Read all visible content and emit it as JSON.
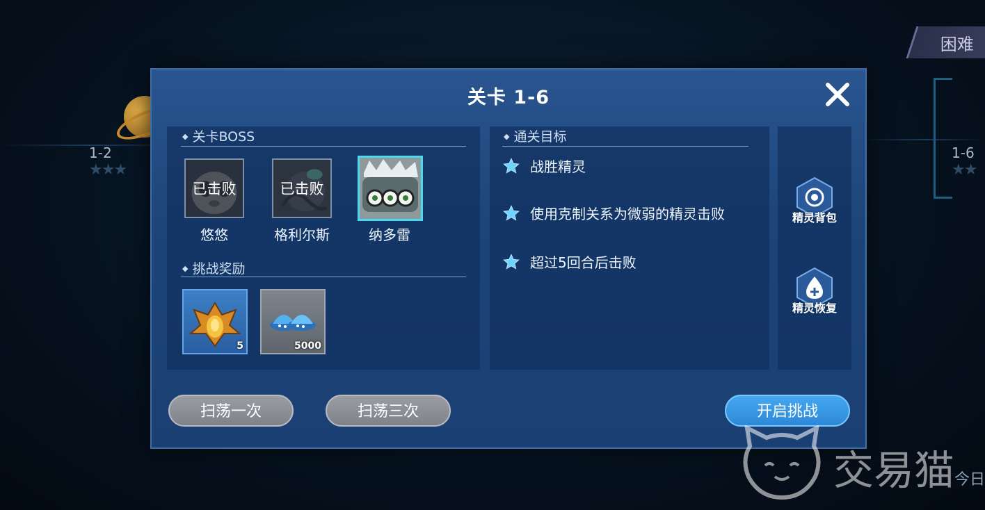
{
  "background": {
    "left_node_label": "1-2",
    "right_node_label": "1-6",
    "difficulty_tab": "困难",
    "corner_text": "今日"
  },
  "dialog": {
    "title": "关卡 1-6",
    "close_icon": "close-icon",
    "boss_section": {
      "heading": "关卡BOSS",
      "bosses": [
        {
          "name": "悠悠",
          "status": "已击败"
        },
        {
          "name": "格利尔斯",
          "status": "已击败"
        },
        {
          "name": "纳多雷",
          "status": ""
        }
      ]
    },
    "reward_section": {
      "heading": "挑战奖励",
      "rewards": [
        {
          "icon": "gold-emblem-icon",
          "count": "5"
        },
        {
          "icon": "blue-ufo-capsule-icon",
          "count": "5000"
        }
      ]
    },
    "goal_section": {
      "heading": "通关目标",
      "goals": [
        "战胜精灵",
        "使用克制关系为微弱的精灵击败",
        "超过5回合后击败"
      ]
    },
    "side_buttons": {
      "bag": "精灵背包",
      "heal": "精灵恢复"
    },
    "buttons": {
      "sweep_once": "扫荡一次",
      "sweep_three": "扫荡三次",
      "start_challenge": "开启挑战"
    }
  },
  "watermark": "交易猫"
}
